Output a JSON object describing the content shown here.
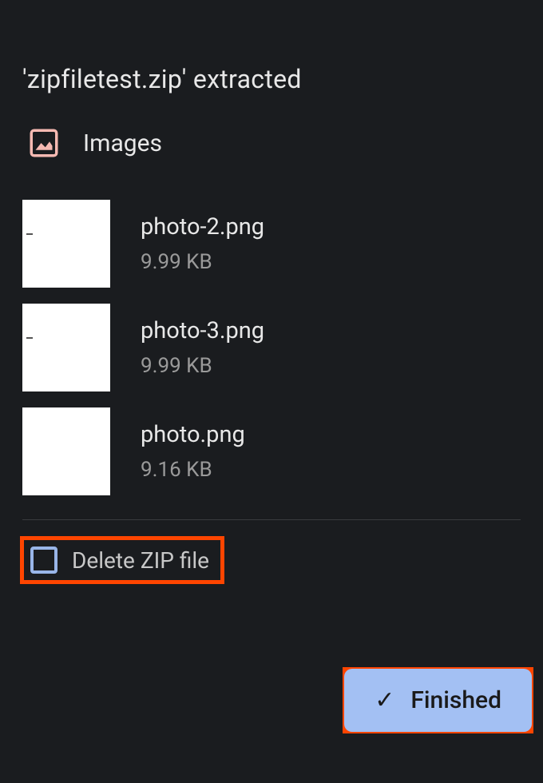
{
  "title": "'zipfiletest.zip' extracted",
  "section": {
    "label": "Images",
    "icon": "image-icon"
  },
  "files": [
    {
      "name": "photo-2.png",
      "size": "9.99 KB"
    },
    {
      "name": "photo-3.png",
      "size": "9.99 KB"
    },
    {
      "name": "photo.png",
      "size": "9.16 KB"
    }
  ],
  "delete_checkbox": {
    "label": "Delete ZIP file",
    "checked": false
  },
  "finished_button": {
    "label": "Finished",
    "icon": "check-icon"
  },
  "colors": {
    "highlight": "#ff4500",
    "accent": "#a3c0f3",
    "background": "#1a1c1f"
  }
}
